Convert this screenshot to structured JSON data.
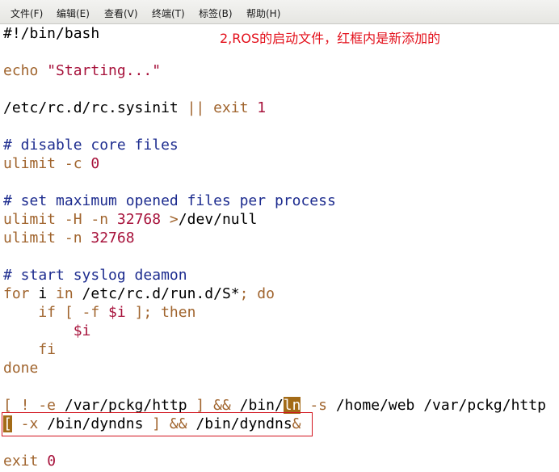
{
  "menubar": {
    "items": [
      "文件(F)",
      "编辑(E)",
      "查看(V)",
      "终端(T)",
      "标签(B)",
      "帮助(H)"
    ]
  },
  "annotation": "2,ROS的启动文件，红框内是新添加的",
  "editor": {
    "lines": [
      {
        "segments": [
          {
            "t": "#!/bin/bash",
            "c": "plain"
          }
        ]
      },
      {
        "segments": []
      },
      {
        "segments": [
          {
            "t": "echo ",
            "c": "kw"
          },
          {
            "t": "\"Starting...\"",
            "c": "str"
          }
        ]
      },
      {
        "segments": []
      },
      {
        "segments": [
          {
            "t": "/etc/rc.d/rc.sysinit ",
            "c": "plain"
          },
          {
            "t": "|| exit ",
            "c": "kw"
          },
          {
            "t": "1",
            "c": "num"
          }
        ]
      },
      {
        "segments": []
      },
      {
        "segments": [
          {
            "t": "# disable core files",
            "c": "cm"
          }
        ]
      },
      {
        "segments": [
          {
            "t": "ulimit -c ",
            "c": "kw"
          },
          {
            "t": "0",
            "c": "num"
          }
        ]
      },
      {
        "segments": []
      },
      {
        "segments": [
          {
            "t": "# set maximum opened files per process",
            "c": "cm"
          }
        ]
      },
      {
        "segments": [
          {
            "t": "ulimit -H -n ",
            "c": "kw"
          },
          {
            "t": "32768",
            "c": "num"
          },
          {
            "t": " >",
            "c": "kw"
          },
          {
            "t": "/dev/null",
            "c": "plain"
          }
        ]
      },
      {
        "segments": [
          {
            "t": "ulimit -n ",
            "c": "kw"
          },
          {
            "t": "32768",
            "c": "num"
          }
        ]
      },
      {
        "segments": []
      },
      {
        "segments": [
          {
            "t": "# start syslog deamon",
            "c": "cm"
          }
        ]
      },
      {
        "segments": [
          {
            "t": "for",
            "c": "kw"
          },
          {
            "t": " i ",
            "c": "plain"
          },
          {
            "t": "in",
            "c": "kw"
          },
          {
            "t": " /etc/rc.d/run.d/S*",
            "c": "plain"
          },
          {
            "t": "; do",
            "c": "kw"
          }
        ]
      },
      {
        "segments": [
          {
            "t": "    if [ -f ",
            "c": "kw"
          },
          {
            "t": "$i",
            "c": "num"
          },
          {
            "t": " ]; then",
            "c": "kw"
          }
        ]
      },
      {
        "segments": [
          {
            "t": "        ",
            "c": "plain"
          },
          {
            "t": "$i",
            "c": "num"
          }
        ]
      },
      {
        "segments": [
          {
            "t": "    fi",
            "c": "kw"
          }
        ]
      },
      {
        "segments": [
          {
            "t": "done",
            "c": "kw"
          }
        ]
      },
      {
        "segments": []
      },
      {
        "segments": [
          {
            "t": "[ ! -e ",
            "c": "kw"
          },
          {
            "t": "/var/pckg/http",
            "c": "plain"
          },
          {
            "t": " ] && ",
            "c": "kw"
          },
          {
            "t": "/bin/",
            "c": "plain"
          },
          {
            "t": "ln",
            "c": "cursor"
          },
          {
            "t": " -s ",
            "c": "kw"
          },
          {
            "t": "/home/web /var/pckg/http",
            "c": "plain"
          }
        ]
      },
      {
        "segments": [
          {
            "t": "[",
            "c": "cursor"
          },
          {
            "t": " -x ",
            "c": "kw"
          },
          {
            "t": "/bin/dyndns",
            "c": "plain"
          },
          {
            "t": " ] && ",
            "c": "kw"
          },
          {
            "t": "/bin/dyndns",
            "c": "plain"
          },
          {
            "t": "&",
            "c": "kw"
          }
        ]
      },
      {
        "segments": []
      },
      {
        "segments": [
          {
            "t": "exit ",
            "c": "kw"
          },
          {
            "t": "0",
            "c": "num"
          }
        ]
      }
    ]
  }
}
